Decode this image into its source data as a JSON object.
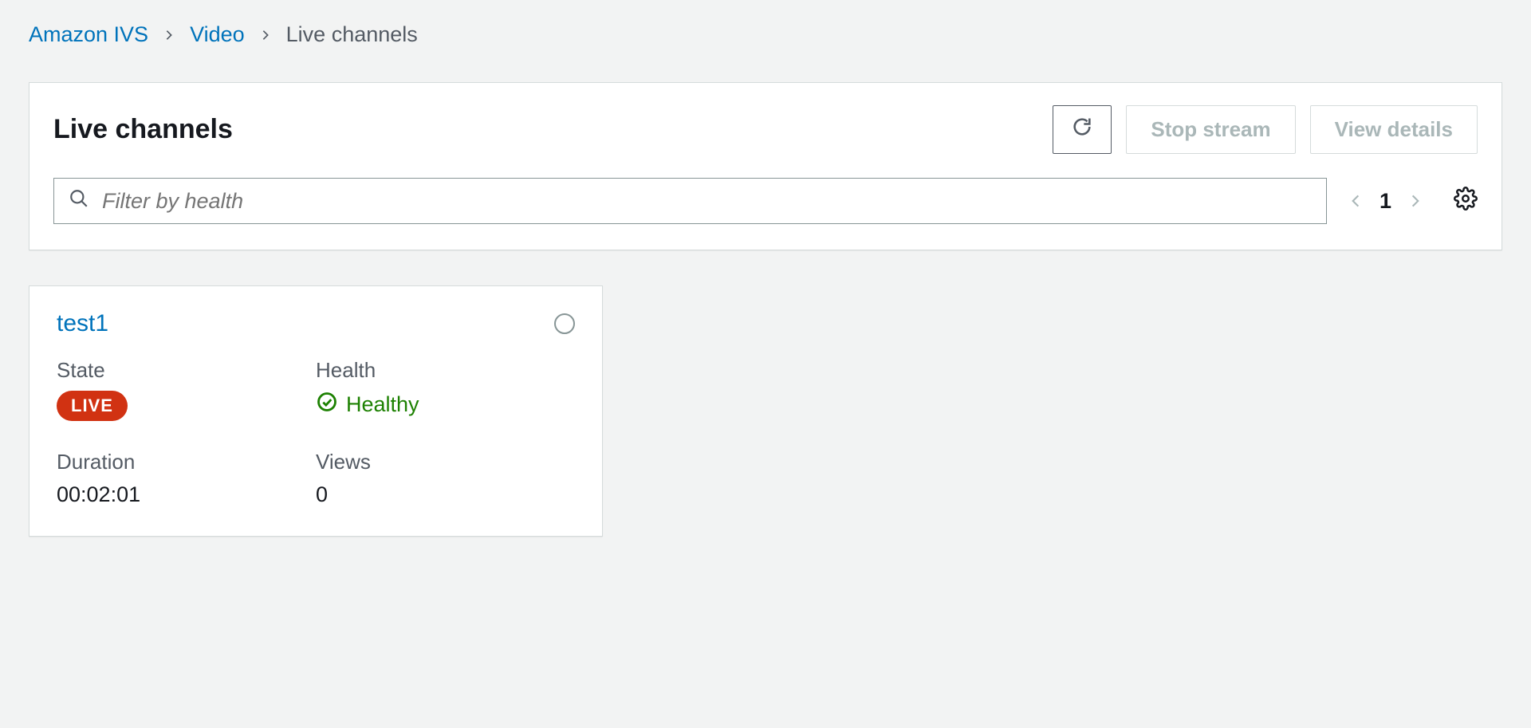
{
  "breadcrumb": {
    "items": [
      {
        "label": "Amazon IVS",
        "href": true
      },
      {
        "label": "Video",
        "href": true
      },
      {
        "label": "Live channels",
        "href": false
      }
    ]
  },
  "header": {
    "title": "Live channels",
    "actions": {
      "stop_stream": "Stop stream",
      "view_details": "View details"
    },
    "filter": {
      "placeholder": "Filter by health"
    },
    "pagination": {
      "page": "1"
    }
  },
  "card": {
    "title": "test1",
    "fields": {
      "state_label": "State",
      "state_value": "LIVE",
      "health_label": "Health",
      "health_value": "Healthy",
      "duration_label": "Duration",
      "duration_value": "00:02:01",
      "views_label": "Views",
      "views_value": "0"
    }
  }
}
